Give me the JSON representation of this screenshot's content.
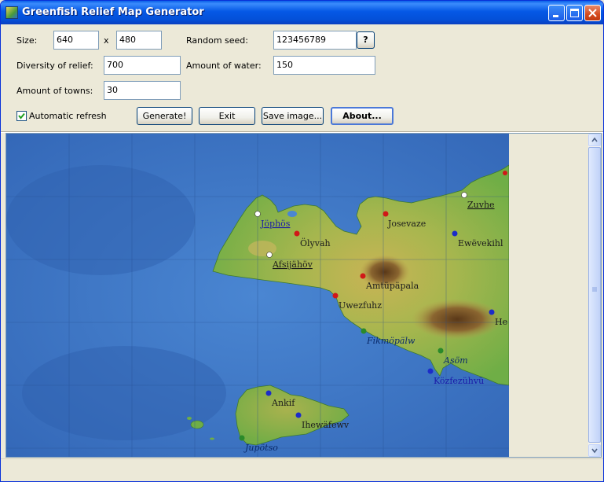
{
  "window": {
    "title": "Greenfish Relief Map Generator"
  },
  "form": {
    "size_label": "Size:",
    "width_value": "640",
    "x_label": "x",
    "height_value": "480",
    "seed_label": "Random seed:",
    "seed_value": "123456789",
    "seed_button": "?",
    "diversity_label": "Diversity of relief:",
    "diversity_value": "700",
    "water_label": "Amount of water:",
    "water_value": "150",
    "towns_label": "Amount of towns:",
    "towns_value": "30",
    "auto_refresh_label": "Automatic refresh",
    "auto_refresh_checked": true
  },
  "buttons": {
    "generate": "Generate!",
    "exit": "Exit",
    "save": "Save image...",
    "about": "About..."
  },
  "map": {
    "towns": [
      {
        "name": "Zuvhe",
        "kind": "white-capital"
      },
      {
        "name": "Jöphös",
        "kind": "white-capital"
      },
      {
        "name": "Josevaze",
        "kind": "red"
      },
      {
        "name": "Ölyvah",
        "kind": "red"
      },
      {
        "name": "Ewëvekihl",
        "kind": "blue"
      },
      {
        "name": "Afsijähöv",
        "kind": "white-capital"
      },
      {
        "name": "Amtüpäpala",
        "kind": "red"
      },
      {
        "name": "Uwezfuhz",
        "kind": "red"
      },
      {
        "name": "He",
        "kind": "blue"
      },
      {
        "name": "Fikmöpälw",
        "kind": "green"
      },
      {
        "name": "Asöm",
        "kind": "green"
      },
      {
        "name": "Közfezühvü",
        "kind": "blue"
      },
      {
        "name": "Ankif",
        "kind": "blue"
      },
      {
        "name": "Ihewäfewv",
        "kind": "blue"
      },
      {
        "name": "Jupötso",
        "kind": "green"
      }
    ],
    "colors": {
      "sea": "#3a74c4",
      "deep_sea": "#2a5aa8",
      "lowland": "#7ab34a",
      "highland": "#c8b55a",
      "mountain": "#6e4a24",
      "red_town": "#d01818",
      "blue_town": "#1c2cc8",
      "green_town": "#2a8a2a",
      "white_town": "#ffffff"
    }
  }
}
